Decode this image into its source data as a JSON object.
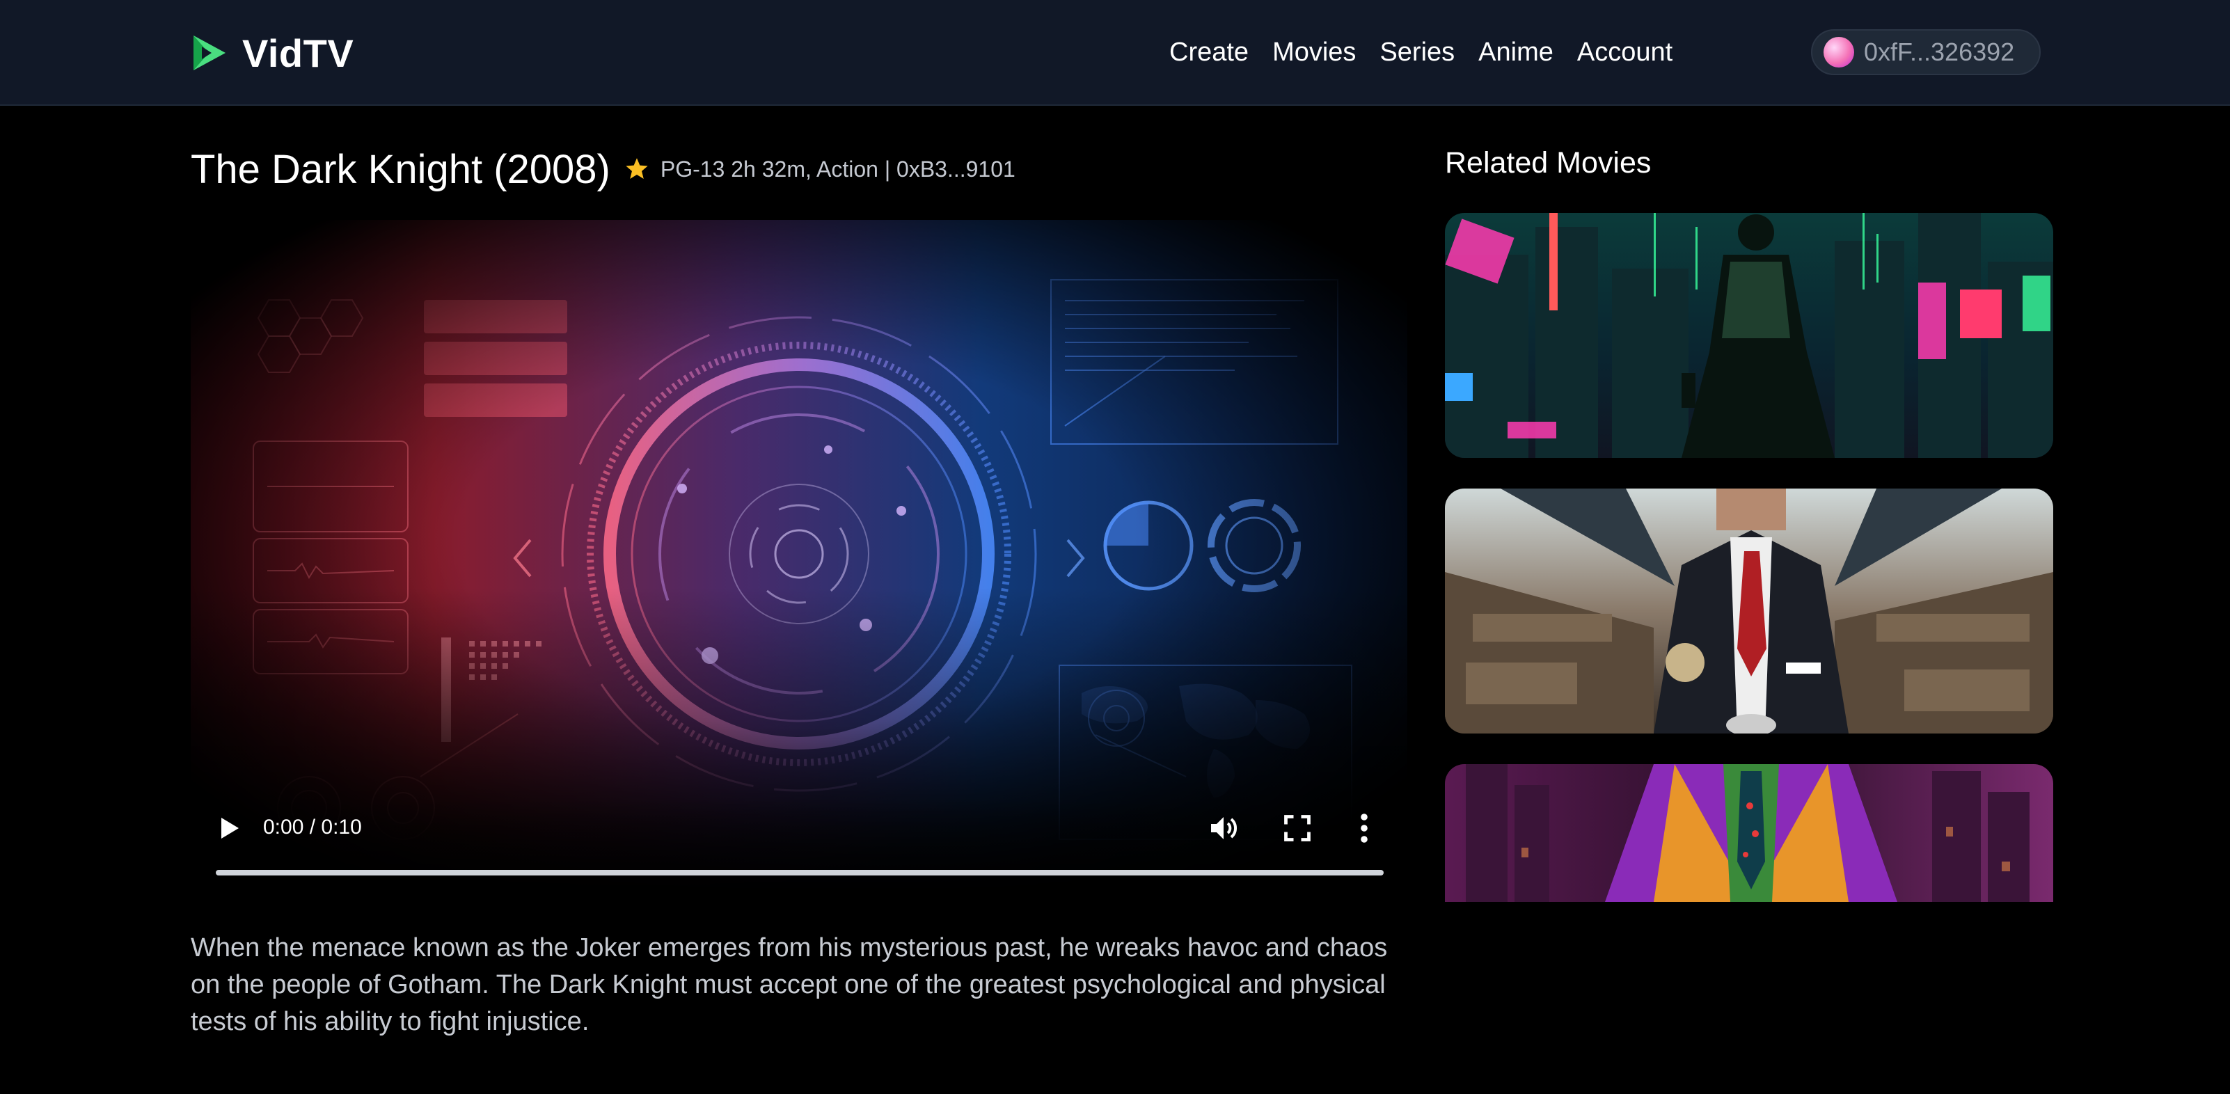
{
  "header": {
    "brand": "VidTV",
    "logo_icon": "play-logo-icon",
    "nav": [
      "Create",
      "Movies",
      "Series",
      "Anime",
      "Account"
    ],
    "wallet_address": "0xfF...326392"
  },
  "movie": {
    "title": "The Dark Knight (2008)",
    "meta": "PG-13 2h 32m, Action | 0xB3...9101",
    "description": "When the menace known as the Joker emerges from his mysterious past, he wreaks havoc and chaos on the people of Gotham. The Dark Knight must accept one of the greatest psychological and physical tests of his ability to fight injustice."
  },
  "player": {
    "time": "0:00 / 0:10",
    "progress": 0
  },
  "related": {
    "title": "Related Movies"
  },
  "colors": {
    "header_bg": "#111827",
    "accent": "#22c55e",
    "star": "#fbbf24"
  }
}
